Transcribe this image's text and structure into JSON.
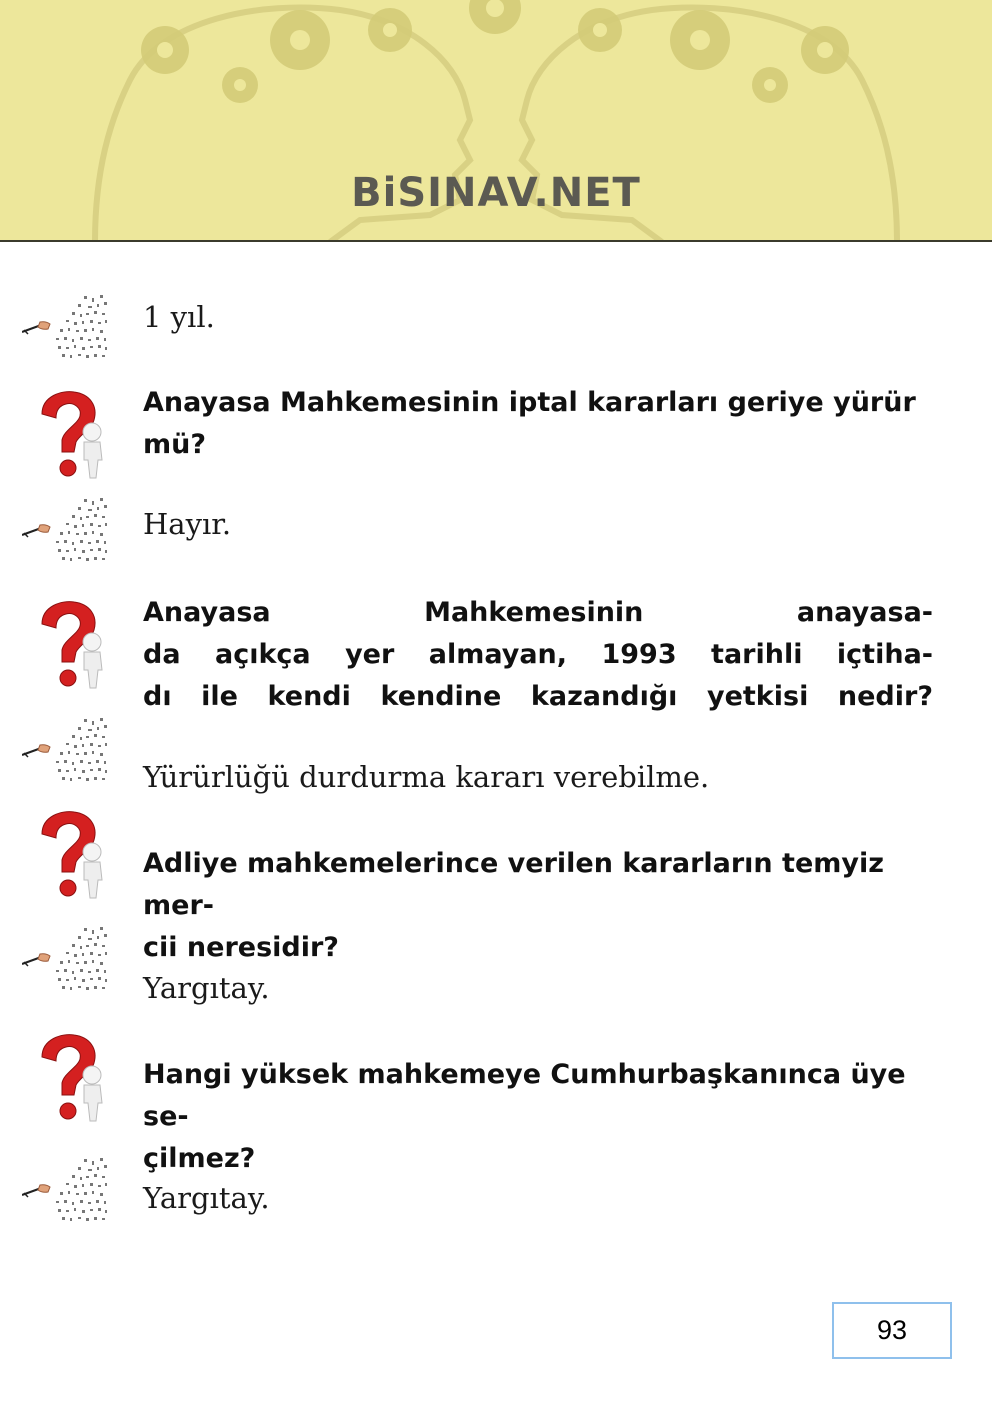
{
  "header": {
    "brand": "BiSINAV.NET"
  },
  "items": [
    {
      "type": "answer",
      "text": "1 yıl."
    },
    {
      "type": "question",
      "lines": [
        "Anayasa Mahkemesinin iptal kararları geriye yürür",
        "mü?"
      ]
    },
    {
      "type": "answer",
      "text": "Hayır."
    },
    {
      "type": "question",
      "lines": [
        "Anayasa Mahkemesinin anayasa-",
        "da açıkça yer almayan, 1993 tarihli içtiha-",
        "dı ile kendi kendine kazandığı yetkisi nedir?"
      ]
    },
    {
      "type": "answer",
      "text": "Yürürlüğü durdurma kararı verebilme."
    },
    {
      "type": "question",
      "lines": [
        "Adliye mahkemelerince verilen kararların temyiz mer-",
        "cii neresidir?"
      ]
    },
    {
      "type": "answer",
      "text": "Yargıtay."
    },
    {
      "type": "question",
      "lines": [
        "Hangi yüksek mahkemeye Cumhurbaşkanınca üye se-",
        "çilmez?"
      ]
    },
    {
      "type": "answer",
      "text": "Yargıtay."
    }
  ],
  "footer": {
    "page_number": "93"
  },
  "icons": {
    "question": "question-mark-figure-icon",
    "answer": "pen-writing-icon"
  },
  "colors": {
    "header_bg": "#ede79b",
    "brand": "#5b5a52",
    "question_mark": "#d42020",
    "page_box_border": "#8fc0ec"
  }
}
